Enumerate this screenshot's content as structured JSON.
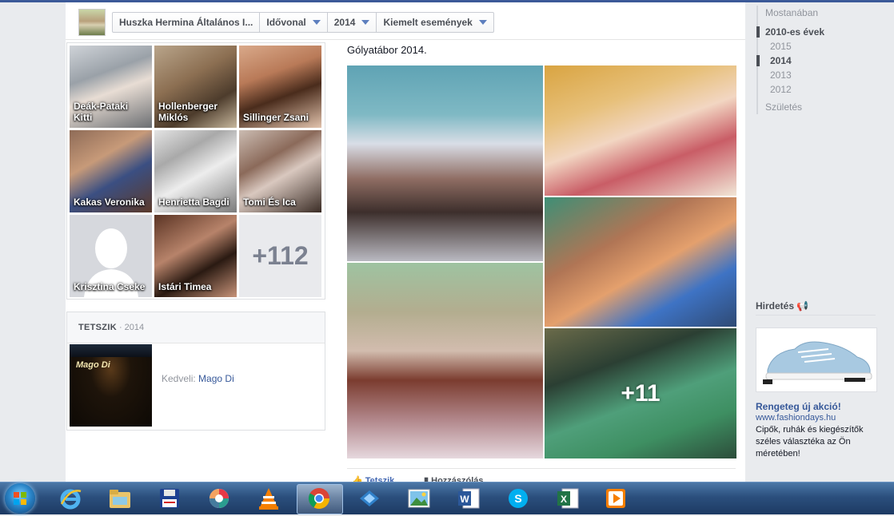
{
  "header": {
    "crumbs": [
      {
        "label": "Huszka Hermina Általános I..."
      },
      {
        "label": "Idővonal"
      },
      {
        "label": "2014"
      },
      {
        "label": "Kiemelt események"
      }
    ]
  },
  "friends": {
    "tiles": [
      {
        "name": "Deák-Pataki Kitti"
      },
      {
        "name": "Hollenberger Miklós"
      },
      {
        "name": "Sillinger Zsani"
      },
      {
        "name": "Kakas Veronika"
      },
      {
        "name": "Henrietta Bagdi"
      },
      {
        "name": "Tomi És Ica"
      },
      {
        "name": "Krisztina Cseke"
      },
      {
        "name": "Istári Timea"
      }
    ],
    "more": "+112"
  },
  "likes": {
    "title": "TETSZIK",
    "sep": "·",
    "year": "2014",
    "liked_by_label": "Kedveli:",
    "page_name": "Mago Di",
    "image_sign": "Mago Di"
  },
  "post": {
    "title": "Gólyatábor 2014.",
    "more_photos": "+11",
    "like_label": "Tetszik",
    "comment_label": "Hozzászólás"
  },
  "timeline_nav": {
    "items": [
      {
        "label": "Mostanában"
      },
      {
        "label": "2010-es évek"
      },
      {
        "label": "2015"
      },
      {
        "label": "2014"
      },
      {
        "label": "2013"
      },
      {
        "label": "2012"
      },
      {
        "label": "Születés"
      }
    ]
  },
  "ads": {
    "heading": "Hirdetés",
    "title": "Rengeteg új akció!",
    "url": "www.fashiondays.hu",
    "text": "Cipők, ruhák és kiegészítők széles választéka az Ön méretében!"
  },
  "taskbar": {
    "icons": [
      "start-orb",
      "internet-explorer",
      "file-explorer",
      "floppy-save",
      "picasa",
      "vlc",
      "chrome",
      "shared-folder",
      "photo-viewer",
      "word",
      "skype",
      "excel",
      "media-player"
    ]
  },
  "colors": {
    "link": "#365899",
    "fb_blue": "#3b5998",
    "page_bg": "#e9ebee"
  }
}
